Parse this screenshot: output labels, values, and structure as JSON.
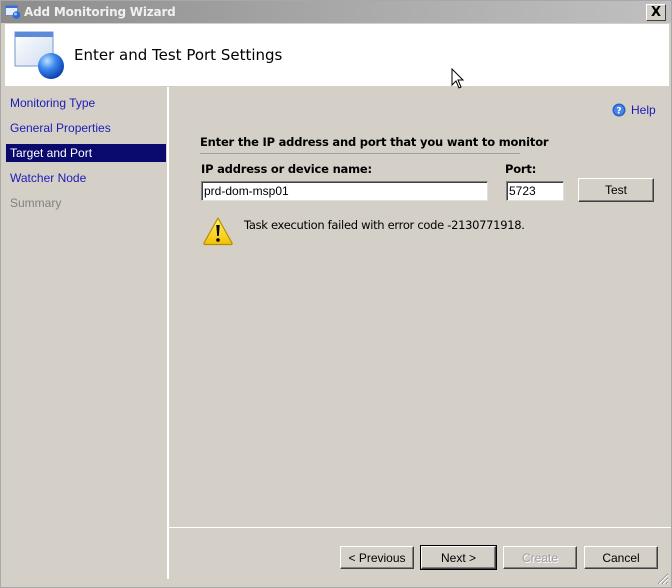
{
  "window": {
    "title": "Add Monitoring Wizard",
    "close_label": "X"
  },
  "header": {
    "title": "Enter and Test Port Settings"
  },
  "sidebar": {
    "items": [
      {
        "label": "Monitoring Type",
        "state": "link"
      },
      {
        "label": "General Properties",
        "state": "link"
      },
      {
        "label": "Target and Port",
        "state": "selected"
      },
      {
        "label": "Watcher Node",
        "state": "link"
      },
      {
        "label": "Summary",
        "state": "disabled"
      }
    ]
  },
  "content": {
    "help_label": "Help",
    "section_title": "Enter the IP address and port that you want to monitor",
    "ip_label": "IP address or device name:",
    "ip_value": "prd-dom-msp01",
    "port_label": "Port:",
    "port_value": "5723",
    "test_button": "Test",
    "warning_message": "Task execution failed with error code -2130771918."
  },
  "footer": {
    "previous_button": "< Previous",
    "next_button": "Next >",
    "create_button": "Create",
    "cancel_button": "Cancel"
  },
  "colors": {
    "selected_bg": "#0a0a6e",
    "link": "#1c1cb4",
    "dialog_bg": "#d4d0c8"
  }
}
